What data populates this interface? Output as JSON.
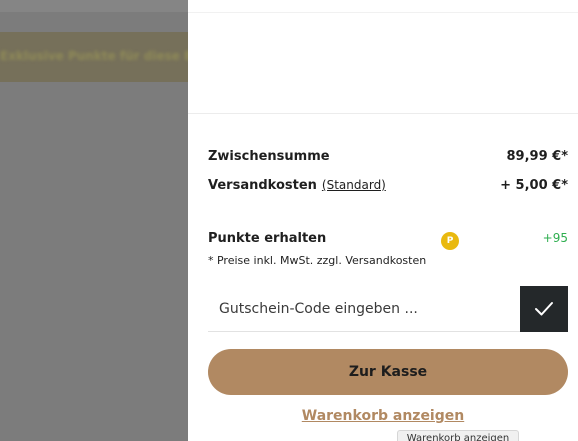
{
  "backdrop": {
    "banner_text": "Exklusive Punkte für diese Bestellung"
  },
  "summary": {
    "subtotal_label": "Zwischensumme",
    "subtotal_value": "89,99 €*",
    "shipping_label": "Versandkosten",
    "shipping_link": "(Standard)",
    "shipping_value": "+ 5,00 €*",
    "points_label": "Punkte erhalten",
    "points_badge": "P",
    "points_value": "+95",
    "note": "* Preise inkl. MwSt. zzgl. Versandkosten"
  },
  "voucher": {
    "placeholder": "Gutschein-Code eingeben ...",
    "submit_icon": "check-icon"
  },
  "actions": {
    "checkout_label": "Zur Kasse",
    "view_cart_label": "Warenkorb anzeigen"
  },
  "tooltip": {
    "text": "Warenkorb anzeigen"
  },
  "colors": {
    "accent": "#b18962",
    "dark_button": "#24282a",
    "points_badge": "#e9b90f",
    "points_value": "#2eae4f",
    "overlay": "#7b7b7b"
  }
}
